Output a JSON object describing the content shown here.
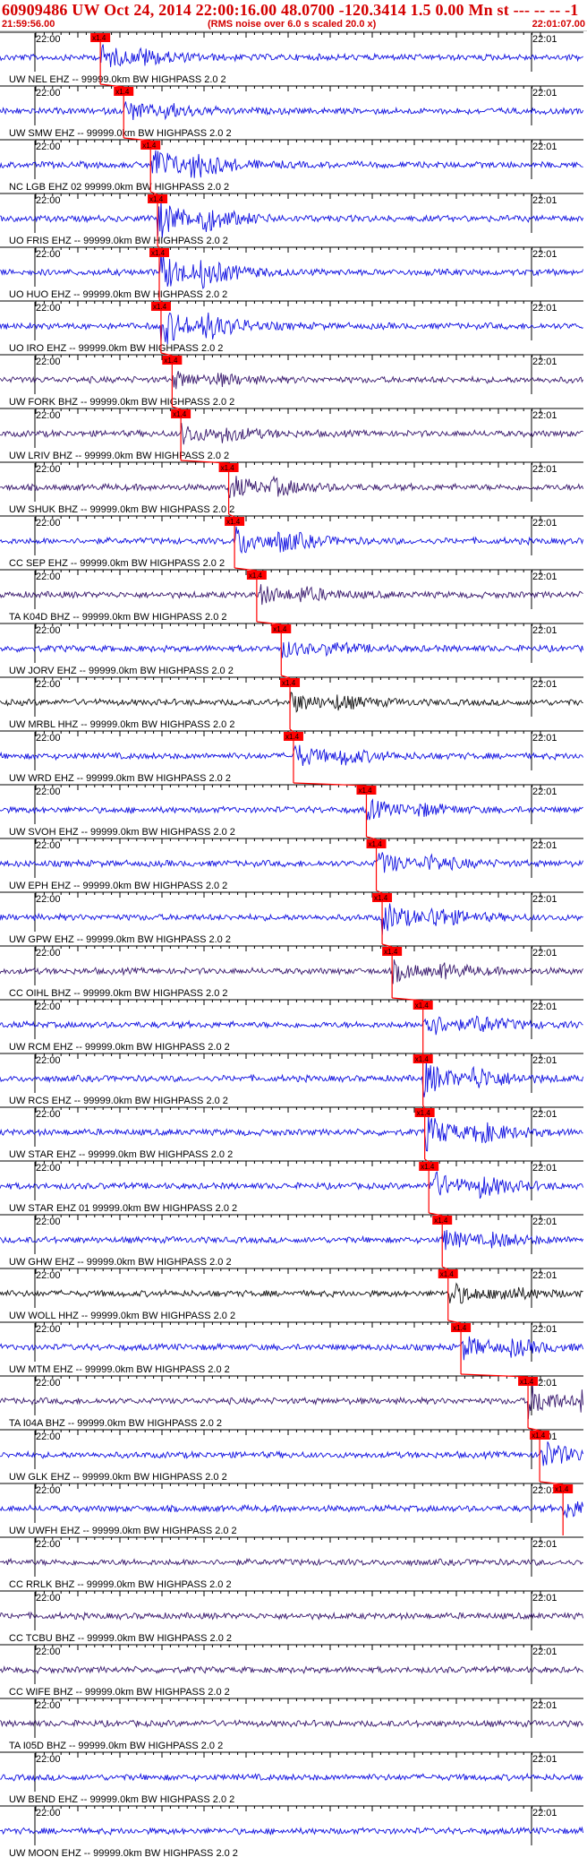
{
  "header": {
    "title": "60909486 UW Oct 24, 2014 22:00:16.00   48.0700 -120.3414  1.5 0.00 Mn st --- -- --  -1",
    "start_time": "21:59:56.00",
    "note": "(RMS noise over 6.0 s scaled 20.0 x)",
    "end_time": "22:01:07.00"
  },
  "chart_data": {
    "type": "line",
    "minute_label_start": "22:00",
    "minute_label_end": "22:01",
    "pick_label": "x1.4",
    "traces": [
      {
        "label": "UW NEL EHZ -- 99999.0km BW  HIGHPASS  2.0  2",
        "color": "#1010e0",
        "pick": 0.172,
        "event_amp": 0.6
      },
      {
        "label": "UW SMW EHZ -- 99999.0km BW  HIGHPASS  2.0  2",
        "color": "#1010e0",
        "pick": 0.212,
        "event_amp": 0.5
      },
      {
        "label": "NC LGB EHZ 02 99999.0km BW  HIGHPASS  2.0  2",
        "color": "#1010e0",
        "pick": 0.258,
        "event_amp": 1.0
      },
      {
        "label": "UO FRIS EHZ -- 99999.0km BW  HIGHPASS  2.0  2",
        "color": "#1010e0",
        "pick": 0.27,
        "event_amp": 1.0
      },
      {
        "label": "UO HUO EHZ -- 99999.0km BW  HIGHPASS  2.0  2",
        "color": "#1010e0",
        "pick": 0.273,
        "event_amp": 1.0
      },
      {
        "label": "UO IRO EHZ -- 99999.0km BW  HIGHPASS  2.0  2",
        "color": "#1010e0",
        "pick": 0.276,
        "event_amp": 1.0
      },
      {
        "label": "UW FORK BHZ -- 99999.0km BW  HIGHPASS  2.0  2",
        "color": "#3a1a6e",
        "pick": 0.295,
        "event_amp": 0.4
      },
      {
        "label": "UW LRIV BHZ -- 99999.0km BW  HIGHPASS  2.0  2",
        "color": "#3a1a6e",
        "pick": 0.31,
        "event_amp": 0.5
      },
      {
        "label": "UW SHUK BHZ -- 99999.0km BW  HIGHPASS  2.0  2",
        "color": "#3a1a6e",
        "pick": 0.392,
        "event_amp": 0.6
      },
      {
        "label": "CC SEP EHZ -- 99999.0km BW  HIGHPASS  2.0  2",
        "color": "#1010e0",
        "pick": 0.402,
        "event_amp": 0.8
      },
      {
        "label": "TA K04D BHZ -- 99999.0km BW  HIGHPASS  2.0  2",
        "color": "#3a1a6e",
        "pick": 0.44,
        "event_amp": 0.5
      },
      {
        "label": "UW JORV EHZ -- 99999.0km BW  HIGHPASS  2.0  2",
        "color": "#1010e0",
        "pick": 0.482,
        "event_amp": 0.4
      },
      {
        "label": "UW MRBL HHZ -- 99999.0km BW  HIGHPASS  2.0  2",
        "color": "#111111",
        "pick": 0.497,
        "event_amp": 0.5
      },
      {
        "label": "UW WRD EHZ -- 99999.0km BW  HIGHPASS  2.0  2",
        "color": "#1010e0",
        "pick": 0.503,
        "event_amp": 0.6
      },
      {
        "label": "UW SVOH EHZ -- 99999.0km BW  HIGHPASS  2.0  2",
        "color": "#1010e0",
        "pick": 0.628,
        "event_amp": 0.5
      },
      {
        "label": "UW EPH EHZ -- 99999.0km BW  HIGHPASS  2.0  2",
        "color": "#1010e0",
        "pick": 0.645,
        "event_amp": 0.6
      },
      {
        "label": "UW GPW EHZ -- 99999.0km BW  HIGHPASS  2.0  2",
        "color": "#1010e0",
        "pick": 0.655,
        "event_amp": 0.8
      },
      {
        "label": "CC OIHL BHZ -- 99999.0km BW  HIGHPASS  2.0  2",
        "color": "#3a1a6e",
        "pick": 0.672,
        "event_amp": 0.5
      },
      {
        "label": "UW RCM EHZ -- 99999.0km BW  HIGHPASS  2.0  2",
        "color": "#1010e0",
        "pick": 0.725,
        "event_amp": 0.7
      },
      {
        "label": "UW RCS EHZ -- 99999.0km BW  HIGHPASS  2.0  2",
        "color": "#1010e0",
        "pick": 0.725,
        "event_amp": 0.9
      },
      {
        "label": "UW STAR EHZ -- 99999.0km BW  HIGHPASS  2.0  2",
        "color": "#1010e0",
        "pick": 0.728,
        "event_amp": 0.9
      },
      {
        "label": "UW STAR EHZ 01 99999.0km BW  HIGHPASS  2.0  2",
        "color": "#1010e0",
        "pick": 0.735,
        "event_amp": 0.8
      },
      {
        "label": "UW GHW EHZ -- 99999.0km BW  HIGHPASS  2.0  2",
        "color": "#1010e0",
        "pick": 0.758,
        "event_amp": 0.5
      },
      {
        "label": "UW WOLL HHZ -- 99999.0km BW  HIGHPASS  2.0  2",
        "color": "#111111",
        "pick": 0.768,
        "event_amp": 0.6
      },
      {
        "label": "UW MTM EHZ -- 99999.0km BW  HIGHPASS  2.0  2",
        "color": "#1010e0",
        "pick": 0.79,
        "event_amp": 0.6
      },
      {
        "label": "TA I04A BHZ -- 99999.0km BW  HIGHPASS  2.0  2",
        "color": "#3a1a6e",
        "pick": 0.905,
        "event_amp": 0.8
      },
      {
        "label": "UW GLK EHZ -- 99999.0km BW  HIGHPASS  2.0  2",
        "color": "#1010e0",
        "pick": 0.925,
        "event_amp": 0.8
      },
      {
        "label": "UW UWFH EHZ -- 99999.0km BW  HIGHPASS  2.0  2",
        "color": "#1010e0",
        "pick": 0.965,
        "event_amp": 0.5
      },
      {
        "label": "CC RRLK BHZ -- 99999.0km BW  HIGHPASS  2.0  2",
        "color": "#3a1a6e",
        "pick": null,
        "event_amp": 0
      },
      {
        "label": "CC TCBU BHZ -- 99999.0km BW  HIGHPASS  2.0  2",
        "color": "#3a1a6e",
        "pick": null,
        "event_amp": 0
      },
      {
        "label": "CC WIFE BHZ -- 99999.0km BW  HIGHPASS  2.0  2",
        "color": "#3a1a6e",
        "pick": null,
        "event_amp": 0
      },
      {
        "label": "TA I05D BHZ -- 99999.0km BW  HIGHPASS  2.0  2",
        "color": "#3a1a6e",
        "pick": null,
        "event_amp": 0
      },
      {
        "label": "UW BEND EHZ -- 99999.0km BW  HIGHPASS  2.0  2",
        "color": "#1010e0",
        "pick": null,
        "event_amp": 0
      },
      {
        "label": "UW MOON EHZ -- 99999.0km BW  HIGHPASS  2.0  2",
        "color": "#1010e0",
        "pick": null,
        "event_amp": 0
      }
    ],
    "colors": {
      "pick_line": "#ff0000",
      "pick_box": "#ff0000",
      "axis": "#000000",
      "header_text": "#d40000"
    }
  }
}
